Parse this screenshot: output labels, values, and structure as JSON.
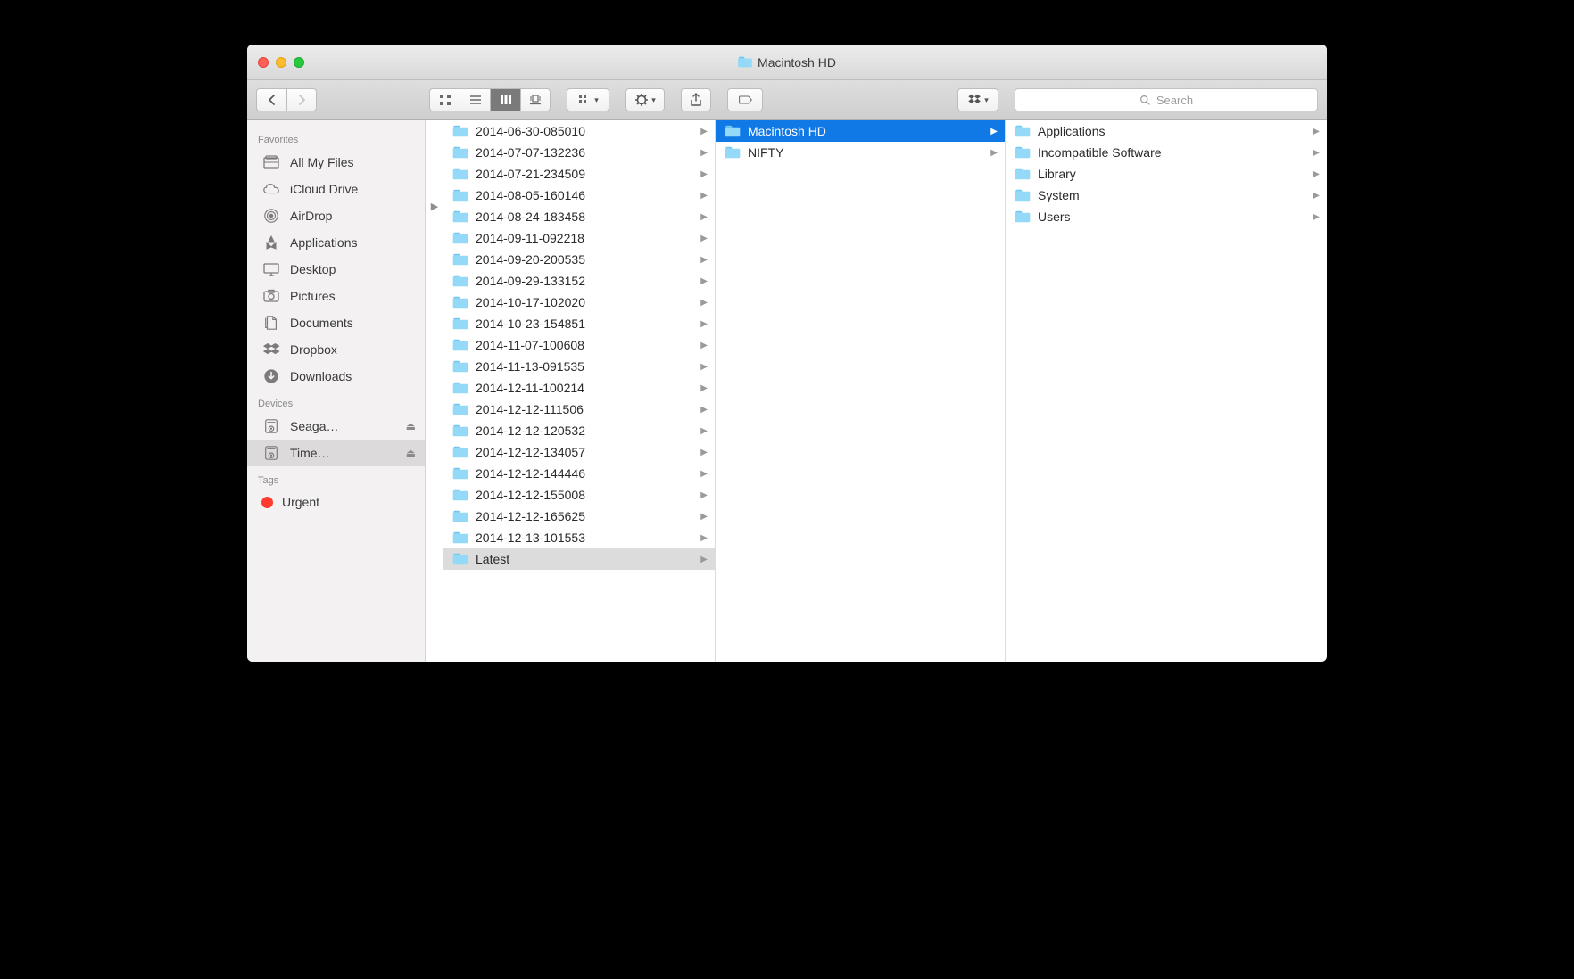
{
  "window": {
    "title": "Macintosh HD"
  },
  "toolbar": {
    "search_placeholder": "Search"
  },
  "sidebar": {
    "favorites_header": "Favorites",
    "devices_header": "Devices",
    "tags_header": "Tags",
    "favorites": [
      {
        "label": "All My Files",
        "icon": "all-my-files"
      },
      {
        "label": "iCloud Drive",
        "icon": "icloud"
      },
      {
        "label": "AirDrop",
        "icon": "airdrop"
      },
      {
        "label": "Applications",
        "icon": "applications"
      },
      {
        "label": "Desktop",
        "icon": "desktop"
      },
      {
        "label": "Pictures",
        "icon": "pictures"
      },
      {
        "label": "Documents",
        "icon": "documents"
      },
      {
        "label": "Dropbox",
        "icon": "dropbox"
      },
      {
        "label": "Downloads",
        "icon": "downloads"
      }
    ],
    "devices": [
      {
        "label": "Seaga…",
        "eject": true
      },
      {
        "label": "Time…",
        "eject": true,
        "selected": true
      }
    ],
    "tags": [
      {
        "label": "Urgent",
        "color": "#ff3b30"
      }
    ]
  },
  "columns": {
    "col1": [
      "2014-06-30-085010",
      "2014-07-07-132236",
      "2014-07-21-234509",
      "2014-08-05-160146",
      "2014-08-24-183458",
      "2014-09-11-092218",
      "2014-09-20-200535",
      "2014-09-29-133152",
      "2014-10-17-102020",
      "2014-10-23-154851",
      "2014-11-07-100608",
      "2014-11-13-091535",
      "2014-12-11-100214",
      "2014-12-12-111506",
      "2014-12-12-120532",
      "2014-12-12-134057",
      "2014-12-12-144446",
      "2014-12-12-155008",
      "2014-12-12-165625",
      "2014-12-13-101553",
      "Latest"
    ],
    "col1_selected": "Latest",
    "col2": [
      "Macintosh HD",
      "NIFTY"
    ],
    "col2_selected": "Macintosh HD",
    "col3": [
      "Applications",
      "Incompatible Software",
      "Library",
      "System",
      "Users"
    ]
  }
}
